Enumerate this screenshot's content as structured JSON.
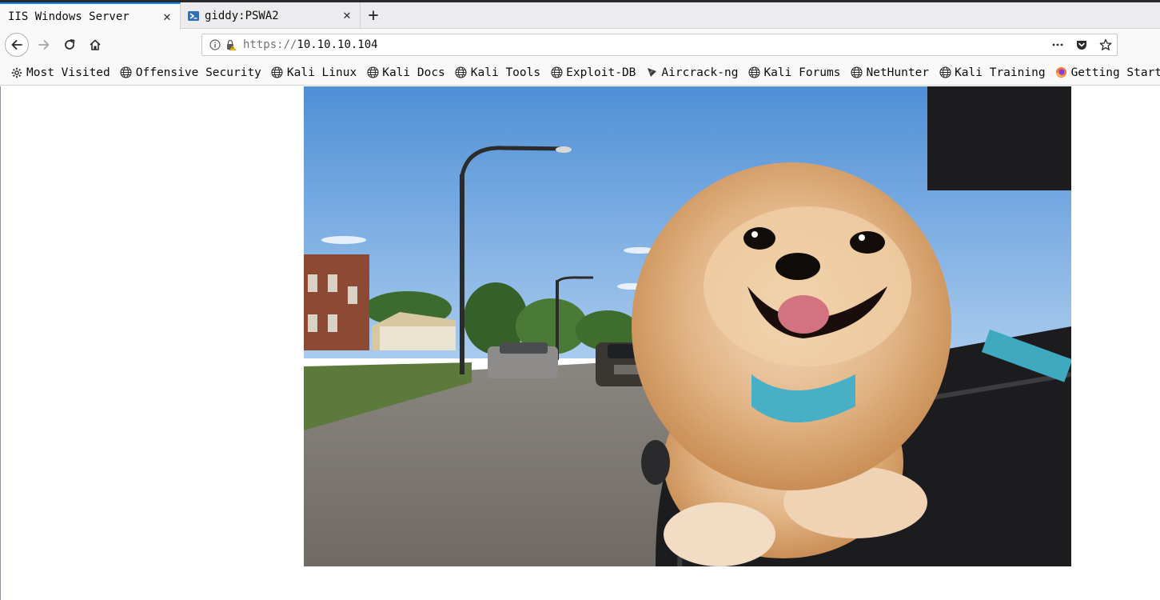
{
  "tabs": [
    {
      "title": "IIS Windows Server",
      "active": true
    },
    {
      "title": "giddy:PSWA2",
      "active": false
    }
  ],
  "toolbar": {
    "url_scheme": "https://",
    "url_host": "10.10.10.104"
  },
  "bookmarks": [
    {
      "label": "Most Visited",
      "icon": "gear-icon"
    },
    {
      "label": "Offensive Security",
      "icon": "globe-icon"
    },
    {
      "label": "Kali Linux",
      "icon": "globe-icon"
    },
    {
      "label": "Kali Docs",
      "icon": "globe-icon"
    },
    {
      "label": "Kali Tools",
      "icon": "globe-icon"
    },
    {
      "label": "Exploit-DB",
      "icon": "globe-icon"
    },
    {
      "label": "Aircrack-ng",
      "icon": "aircrack-icon"
    },
    {
      "label": "Kali Forums",
      "icon": "globe-icon"
    },
    {
      "label": "NetHunter",
      "icon": "globe-icon"
    },
    {
      "label": "Kali Training",
      "icon": "globe-icon"
    },
    {
      "label": "Getting Started",
      "icon": "firefox-icon"
    }
  ],
  "colors": {
    "accent": "#0a84ff",
    "toolbar_bg": "#f9f9fa",
    "tabstrip_bg": "#ececee"
  }
}
